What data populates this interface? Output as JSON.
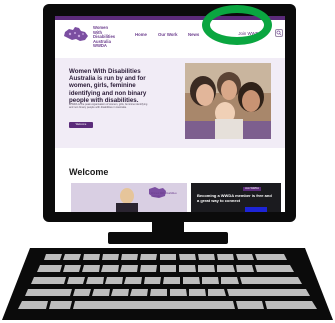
{
  "site": {
    "logo_lines": [
      "Women",
      "With",
      "Disabilities",
      "Australia",
      "WWDA"
    ],
    "nav": [
      "Home",
      "Our Work",
      "News",
      "Join WWDA"
    ],
    "hero": {
      "title": "Women With Disabilities Australia is run by and for women, girls, feminine identifying and non binary people with disabilities.",
      "body": "WWDA is the peak organisation of women, girls, feminine identifying and non binary people with disabilities in Australia.",
      "button": "Welcome"
    },
    "welcome_heading": "Welcome",
    "video_caption": "Women With Disabilities Australia",
    "cta": {
      "tag": "Join WWDA",
      "text": "Becoming a WWDA member is free and a great way to connect"
    }
  },
  "colors": {
    "brand_purple": "#5b2b7a",
    "highlight_ring": "#0aa640",
    "cta_button": "#1d24d6",
    "bezel": "#0b0b0b"
  },
  "icons": [
    "search-icon",
    "australia-map-logo-icon"
  ]
}
